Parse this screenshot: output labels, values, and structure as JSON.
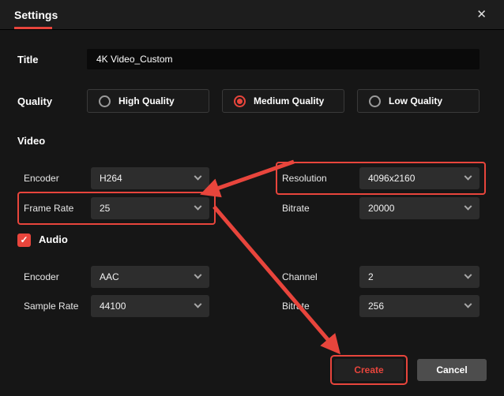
{
  "window": {
    "title": "Settings"
  },
  "icons": {
    "close": "✕",
    "check": "✓"
  },
  "fields": {
    "title": {
      "label": "Title",
      "value": "4K Video_Custom"
    },
    "quality": {
      "label": "Quality",
      "options": [
        {
          "label": "High Quality",
          "selected": false
        },
        {
          "label": "Medium Quality",
          "selected": true
        },
        {
          "label": "Low Quality",
          "selected": false
        }
      ]
    }
  },
  "video": {
    "label": "Video",
    "encoder": {
      "label": "Encoder",
      "value": "H264"
    },
    "resolution": {
      "label": "Resolution",
      "value": "4096x2160"
    },
    "frame_rate": {
      "label": "Frame Rate",
      "value": "25"
    },
    "bitrate": {
      "label": "Bitrate",
      "value": "20000"
    }
  },
  "audio": {
    "label": "Audio",
    "enabled": true,
    "encoder": {
      "label": "Encoder",
      "value": "AAC"
    },
    "channel": {
      "label": "Channel",
      "value": "2"
    },
    "sample_rate": {
      "label": "Sample Rate",
      "value": "44100"
    },
    "bitrate": {
      "label": "Bitrate",
      "value": "256"
    }
  },
  "buttons": {
    "create": "Create",
    "cancel": "Cancel"
  },
  "colors": {
    "accent_red": "#e8453c",
    "titlebar_bg": "#1d1d1d",
    "body_bg": "#161616"
  }
}
